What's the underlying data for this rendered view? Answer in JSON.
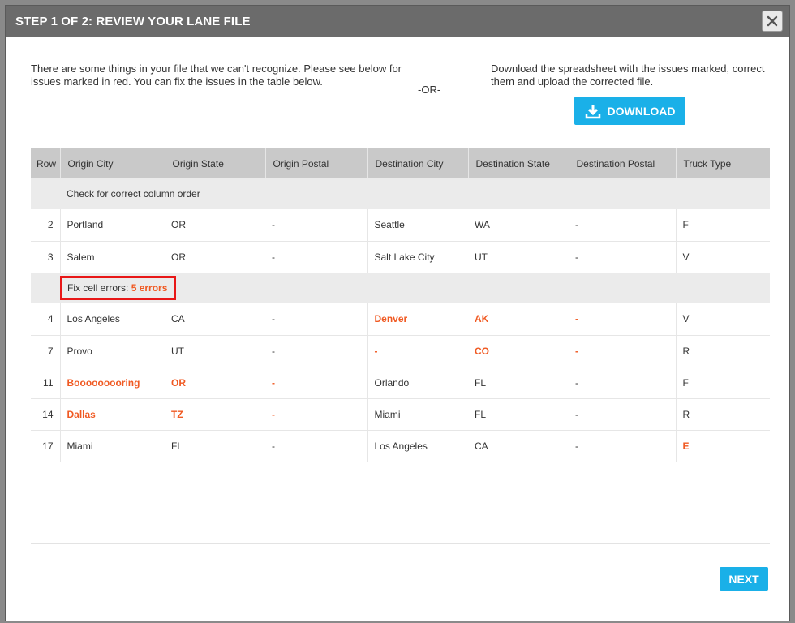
{
  "modal": {
    "title": "STEP 1 OF 2: REVIEW YOUR LANE FILE",
    "close_icon": "close-icon"
  },
  "intro": {
    "left_text": "There are some things in your file that we can't recognize. Please see below for issues marked in red. You can fix the issues in the table below.",
    "or_text": "-OR-",
    "right_text": "Download the spreadsheet with the issues marked, correct them and upload the corrected file.",
    "download_label": "DOWNLOAD",
    "download_icon": "download-icon"
  },
  "table": {
    "headers": [
      "Row",
      "Origin City",
      "Origin State",
      "Origin Postal",
      "Destination City",
      "Destination State",
      "Destination Postal",
      "Truck Type"
    ],
    "section1_label": "Check for correct column order",
    "section1_rows": [
      {
        "row": "2",
        "origin_city": "Portland",
        "origin_state": "OR",
        "origin_postal": "-",
        "dest_city": "Seattle",
        "dest_state": "WA",
        "dest_postal": "-",
        "truck_type": "F"
      },
      {
        "row": "3",
        "origin_city": "Salem",
        "origin_state": "OR",
        "origin_postal": "-",
        "dest_city": "Salt Lake City",
        "dest_state": "UT",
        "dest_postal": "-",
        "truck_type": "V"
      }
    ],
    "section2_label": "Fix cell errors:",
    "section2_error_count": "5 errors",
    "section2_rows": [
      {
        "row": "4",
        "origin_city": "Los Angeles",
        "origin_state": "CA",
        "origin_postal": "-",
        "dest_city": "Denver",
        "dest_state": "AK",
        "dest_postal": "-",
        "truck_type": "V"
      },
      {
        "row": "7",
        "origin_city": "Provo",
        "origin_state": "UT",
        "origin_postal": "-",
        "dest_city": "-",
        "dest_state": "CO",
        "dest_postal": "-",
        "truck_type": "R"
      },
      {
        "row": "11",
        "origin_city": "Booooooooring",
        "origin_state": "OR",
        "origin_postal": "-",
        "dest_city": "Orlando",
        "dest_state": "FL",
        "dest_postal": "-",
        "truck_type": "F"
      },
      {
        "row": "14",
        "origin_city": "Dallas",
        "origin_state": "TZ",
        "origin_postal": "-",
        "dest_city": "Miami",
        "dest_state": "FL",
        "dest_postal": "-",
        "truck_type": "R"
      },
      {
        "row": "17",
        "origin_city": "Miami",
        "origin_state": "FL",
        "origin_postal": "-",
        "dest_city": "Los Angeles",
        "dest_state": "CA",
        "dest_postal": "-",
        "truck_type": "E"
      }
    ]
  },
  "footer": {
    "next_label": "NEXT"
  },
  "colors": {
    "header_bg": "#6b6b6b",
    "accent": "#1ab0e8",
    "error": "#f05a23",
    "highlight_box": "#e81717"
  }
}
